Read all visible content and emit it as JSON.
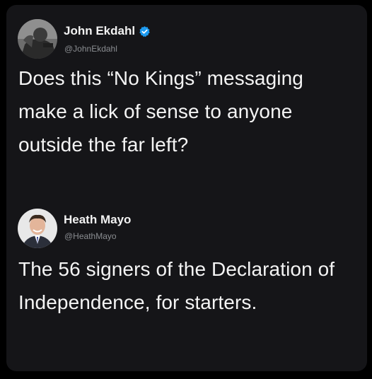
{
  "tweets": [
    {
      "display_name": "John Ekdahl",
      "handle": "@JohnEkdahl",
      "verified": true,
      "text": "Does this “No Kings” messaging make a lick of sense to anyone outside the far left?"
    },
    {
      "display_name": "Heath Mayo",
      "handle": "@HeathMayo",
      "verified": false,
      "text": "The 56 signers of the Declaration of Independence, for starters."
    }
  ],
  "colors": {
    "background": "#000000",
    "card": "#151518",
    "text": "#f4f4f4",
    "handle": "#8a8d91",
    "verified_badge": "#1d9bf0"
  },
  "icons": {
    "verified": "verified-badge-icon"
  }
}
